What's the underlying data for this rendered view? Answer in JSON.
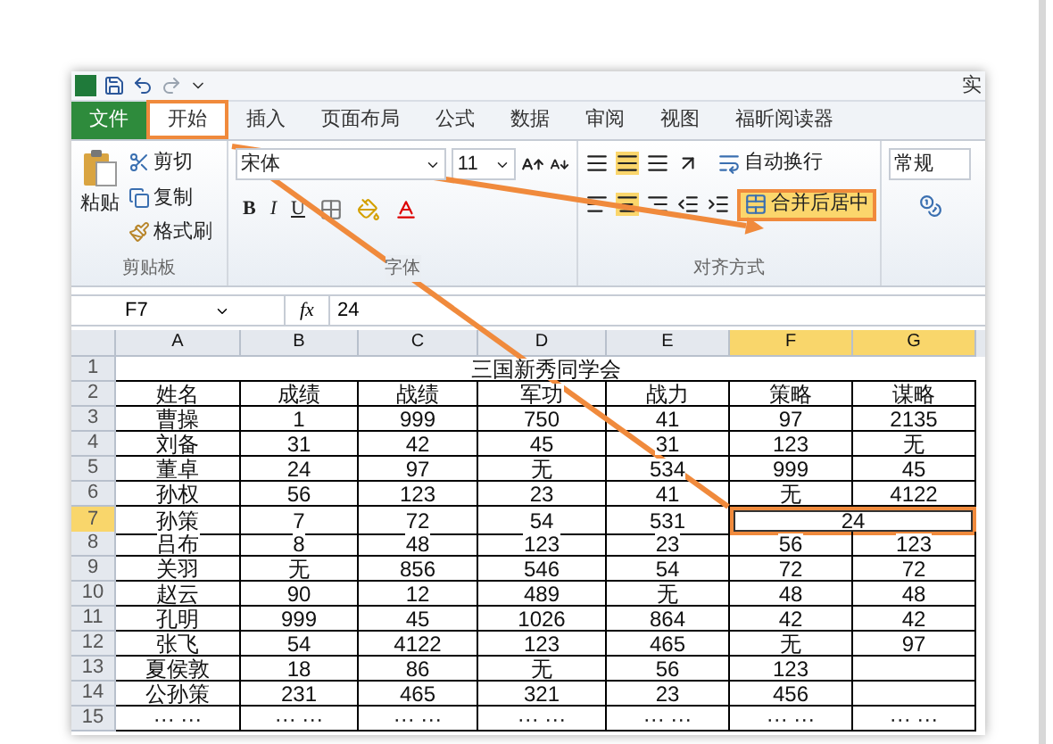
{
  "title_bar": {
    "title": "实"
  },
  "tabs": [
    {
      "label": "文件",
      "kind": "file",
      "selected": false
    },
    {
      "label": "开始",
      "kind": "tab",
      "selected": true
    },
    {
      "label": "插入",
      "kind": "tab",
      "selected": false
    },
    {
      "label": "页面布局",
      "kind": "tab",
      "selected": false
    },
    {
      "label": "公式",
      "kind": "tab",
      "selected": false
    },
    {
      "label": "数据",
      "kind": "tab",
      "selected": false
    },
    {
      "label": "审阅",
      "kind": "tab",
      "selected": false
    },
    {
      "label": "视图",
      "kind": "tab",
      "selected": false
    },
    {
      "label": "福昕阅读器",
      "kind": "tab",
      "selected": false
    }
  ],
  "ribbon": {
    "clipboard": {
      "paste": "粘贴",
      "cut": "剪切",
      "copy": "复制",
      "format_painter": "格式刷",
      "label": "剪贴板"
    },
    "font": {
      "name": "宋体",
      "size": "11",
      "bold": "B",
      "italic": "I",
      "underline": "U",
      "label": "字体"
    },
    "alignment": {
      "wrap": "自动换行",
      "merge": "合并后居中",
      "merge_highlighted": true,
      "label": "对齐方式"
    },
    "number": {
      "format": "常规"
    }
  },
  "formula_bar": {
    "cell": "F7",
    "function_label": "fx",
    "value": "24"
  },
  "sheet": {
    "columns": [
      {
        "label": "A",
        "selected": false
      },
      {
        "label": "B",
        "selected": false
      },
      {
        "label": "C",
        "selected": false
      },
      {
        "label": "D",
        "selected": false
      },
      {
        "label": "E",
        "selected": false
      },
      {
        "label": "F",
        "selected": true
      },
      {
        "label": "G",
        "selected": true
      }
    ],
    "rows": [
      {
        "number": "1",
        "selected": false,
        "kind": "title",
        "title": "三国新秀同学会"
      },
      {
        "number": "2",
        "selected": false,
        "kind": "data",
        "cells": [
          "姓名",
          "成绩",
          "战绩",
          "军功",
          "战力",
          "策略",
          "谋略"
        ]
      },
      {
        "number": "3",
        "selected": false,
        "kind": "data",
        "cells": [
          "曹操",
          "1",
          "999",
          "750",
          "41",
          "97",
          "2135"
        ]
      },
      {
        "number": "4",
        "selected": false,
        "kind": "data",
        "cells": [
          "刘备",
          "31",
          "42",
          "45",
          "31",
          "123",
          "无"
        ]
      },
      {
        "number": "5",
        "selected": false,
        "kind": "data",
        "cells": [
          "董卓",
          "24",
          "97",
          "无",
          "534",
          "999",
          "45"
        ]
      },
      {
        "number": "6",
        "selected": false,
        "kind": "data",
        "cells": [
          "孙权",
          "56",
          "123",
          "23",
          "41",
          "无",
          "4122"
        ]
      },
      {
        "number": "7",
        "selected": true,
        "kind": "merged",
        "cells": [
          "孙策",
          "7",
          "72",
          "54",
          "531"
        ],
        "merged": "24"
      },
      {
        "number": "8",
        "selected": false,
        "kind": "data",
        "cells": [
          "吕布",
          "8",
          "48",
          "123",
          "23",
          "56",
          "123"
        ]
      },
      {
        "number": "9",
        "selected": false,
        "kind": "data",
        "cells": [
          "关羽",
          "无",
          "856",
          "546",
          "54",
          "72",
          "72"
        ]
      },
      {
        "number": "10",
        "selected": false,
        "kind": "data",
        "cells": [
          "赵云",
          "90",
          "12",
          "489",
          "无",
          "48",
          "48"
        ]
      },
      {
        "number": "11",
        "selected": false,
        "kind": "data",
        "cells": [
          "孔明",
          "999",
          "45",
          "1026",
          "864",
          "42",
          "42"
        ]
      },
      {
        "number": "12",
        "selected": false,
        "kind": "data",
        "cells": [
          "张飞",
          "54",
          "4122",
          "123",
          "465",
          "无",
          "97"
        ]
      },
      {
        "number": "13",
        "selected": false,
        "kind": "data",
        "cells": [
          "夏侯敦",
          "18",
          "86",
          "无",
          "56",
          "123",
          null
        ]
      },
      {
        "number": "14",
        "selected": false,
        "kind": "data",
        "cells": [
          "公孙策",
          "231",
          "465",
          "321",
          "23",
          "456",
          null
        ]
      },
      {
        "number": "15",
        "selected": false,
        "kind": "data",
        "cells": [
          "··· ···",
          "··· ···",
          "··· ···",
          "··· ···",
          "··· ···",
          "··· ···",
          "··· ···"
        ]
      }
    ]
  }
}
